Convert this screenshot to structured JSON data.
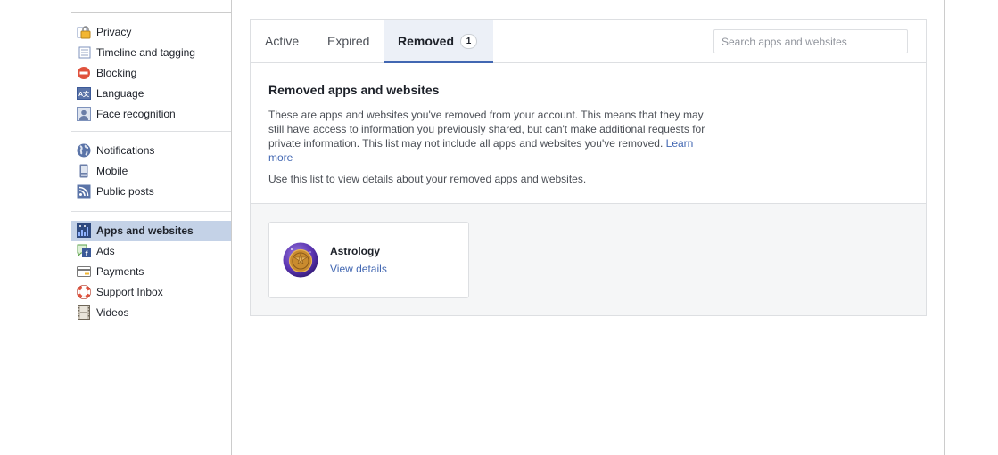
{
  "sidebar": {
    "groups": [
      {
        "items": [
          {
            "label": "Privacy",
            "icon": "lock-icon"
          },
          {
            "label": "Timeline and tagging",
            "icon": "timeline-icon"
          },
          {
            "label": "Blocking",
            "icon": "block-icon"
          },
          {
            "label": "Language",
            "icon": "language-icon"
          },
          {
            "label": "Face recognition",
            "icon": "face-recognition-icon"
          }
        ]
      },
      {
        "items": [
          {
            "label": "Notifications",
            "icon": "globe-icon"
          },
          {
            "label": "Mobile",
            "icon": "mobile-icon"
          },
          {
            "label": "Public posts",
            "icon": "rss-icon"
          }
        ]
      },
      {
        "items": [
          {
            "label": "Apps and websites",
            "icon": "apps-icon",
            "active": true
          },
          {
            "label": "Ads",
            "icon": "ads-icon"
          },
          {
            "label": "Payments",
            "icon": "credit-card-icon"
          },
          {
            "label": "Support Inbox",
            "icon": "lifebuoy-icon"
          },
          {
            "label": "Videos",
            "icon": "film-icon"
          }
        ]
      }
    ]
  },
  "tabs": {
    "active": "Active",
    "expired": "Expired",
    "removed": "Removed",
    "removed_count": "1",
    "selected": "Removed"
  },
  "search": {
    "placeholder": "Search apps and websites",
    "value": ""
  },
  "intro": {
    "title": "Removed apps and websites",
    "body": "These are apps and websites you've removed from your account. This means that they may still have access to information you previously shared, but can't make additional requests for private information. This list may not include all apps and websites you've removed.",
    "learn_more": "Learn more",
    "hint": "Use this list to view details about your removed apps and websites."
  },
  "apps": [
    {
      "name": "Astrology",
      "action": "View details",
      "icon": "astrology-app-icon"
    }
  ],
  "colors": {
    "accent": "#4267b2",
    "active_nav_bg": "#c4d2e7",
    "active_tab_bg": "#ecf0f7"
  }
}
